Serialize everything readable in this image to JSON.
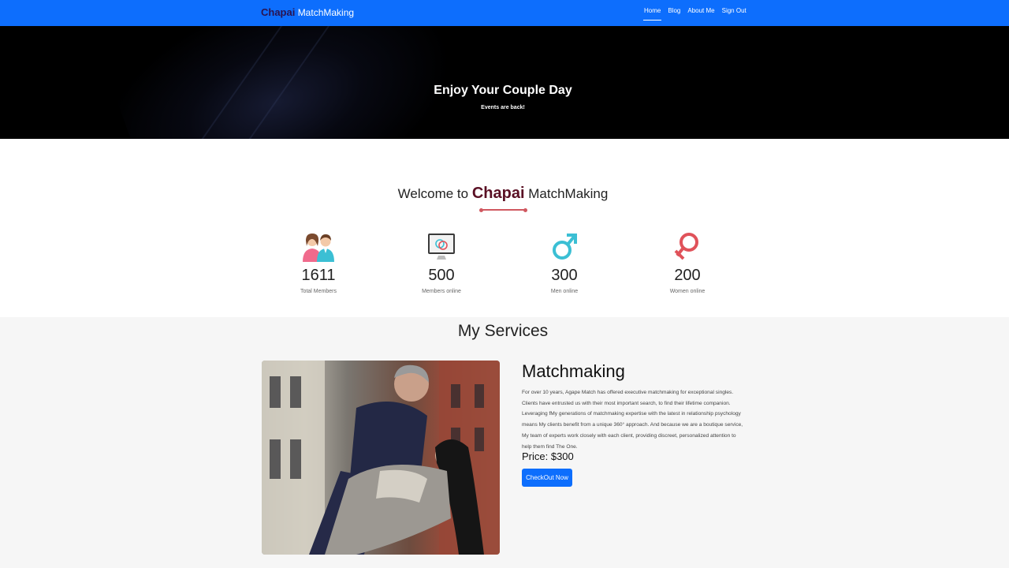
{
  "navbar": {
    "brand_part1": "Chapai",
    "brand_part2": "MatchMaking",
    "links": [
      "Home",
      "Blog",
      "About Me",
      "Sign Out"
    ],
    "active_link": "Home"
  },
  "hero": {
    "title": "Enjoy Your Couple Day",
    "subtitle": "Events are back!"
  },
  "welcome": {
    "prefix": "Welcome to",
    "brand": "Chapai",
    "suffix": "MatchMaking"
  },
  "stats": [
    {
      "icon": "couple-icon",
      "value": "1611",
      "label": "Total Members"
    },
    {
      "icon": "monitor-rings-icon",
      "value": "500",
      "label": "Members online"
    },
    {
      "icon": "male-symbol-icon",
      "value": "300",
      "label": "Men online"
    },
    {
      "icon": "female-symbol-icon",
      "value": "200",
      "label": "Women online"
    }
  ],
  "services": {
    "title": "My Services",
    "item": {
      "title": "Matchmaking",
      "description": "For over 10 years, Agape Match has offered executive matchmaking for exceptional singles. Clients have entrusted us with their most important search, to find their lifetime companion. Leveraging fMy generations of matchmaking expertise with the latest in relationship psychology means My clients benefit from a unique 360° approach. And because we are a boutique service, My team of experts work closely with each client, providing discreet, personalized attention to help them find The One.",
      "price": "Price: $300",
      "button": "CheckOut Now"
    }
  },
  "colors": {
    "navbar": "#0d6efd",
    "brand_accent": "#5a1024",
    "decor": "#d05860",
    "male": "#3bbfd4",
    "female": "#e0525a"
  }
}
